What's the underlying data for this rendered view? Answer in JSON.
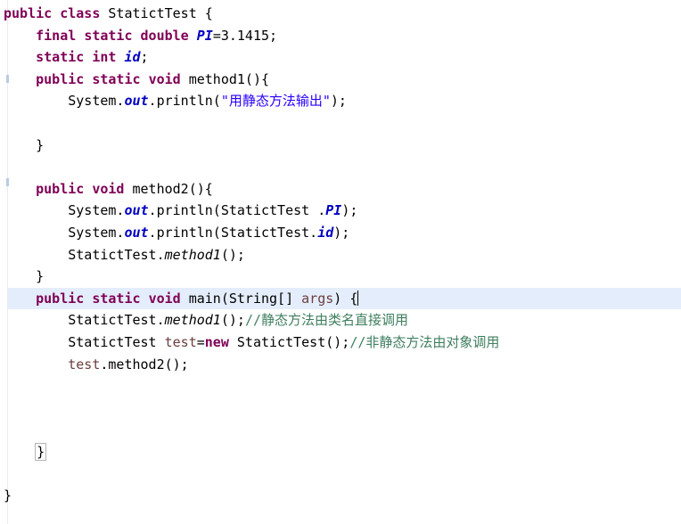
{
  "editor": {
    "language": "java",
    "class_name": "StatictTest",
    "colors": {
      "background": "#ffffff",
      "keyword": "#7f0055",
      "string": "#2a00ff",
      "comment": "#3f7f5f",
      "static_field": "#0000c0",
      "local_variable": "#6a3e3e",
      "plain_text": "#000000",
      "current_line_highlight": "#e4edfb",
      "bracket_match_outline": "#b4b4b4"
    },
    "current_line_number": 14,
    "caret_after": "{"
  },
  "lines": [
    {
      "n": 1,
      "indent": 0,
      "tokens": [
        {
          "t": "public",
          "c": "kw"
        },
        {
          "t": " ",
          "c": "plain"
        },
        {
          "t": "class",
          "c": "kw"
        },
        {
          "t": " ",
          "c": "plain"
        },
        {
          "t": "StatictTest",
          "c": "plain"
        },
        {
          "t": " {",
          "c": "plain"
        }
      ]
    },
    {
      "n": 2,
      "indent": 1,
      "tokens": [
        {
          "t": "final",
          "c": "kw"
        },
        {
          "t": " ",
          "c": "plain"
        },
        {
          "t": "static",
          "c": "kw"
        },
        {
          "t": " ",
          "c": "plain"
        },
        {
          "t": "double",
          "c": "kw"
        },
        {
          "t": " ",
          "c": "plain"
        },
        {
          "t": "PI",
          "c": "field"
        },
        {
          "t": "=",
          "c": "plain"
        },
        {
          "t": "3.1415",
          "c": "num"
        },
        {
          "t": ";",
          "c": "plain"
        }
      ]
    },
    {
      "n": 3,
      "indent": 1,
      "tokens": [
        {
          "t": "static",
          "c": "kw"
        },
        {
          "t": " ",
          "c": "plain"
        },
        {
          "t": "int",
          "c": "kw"
        },
        {
          "t": " ",
          "c": "plain"
        },
        {
          "t": "id",
          "c": "field"
        },
        {
          "t": ";",
          "c": "plain"
        }
      ]
    },
    {
      "n": 4,
      "indent": 1,
      "tokens": [
        {
          "t": "public",
          "c": "kw"
        },
        {
          "t": " ",
          "c": "plain"
        },
        {
          "t": "static",
          "c": "kw"
        },
        {
          "t": " ",
          "c": "plain"
        },
        {
          "t": "void",
          "c": "kw"
        },
        {
          "t": " ",
          "c": "plain"
        },
        {
          "t": "method1(){",
          "c": "plain"
        }
      ]
    },
    {
      "n": 5,
      "indent": 2,
      "tokens": [
        {
          "t": "System.",
          "c": "plain"
        },
        {
          "t": "out",
          "c": "sfield"
        },
        {
          "t": ".println(",
          "c": "plain"
        },
        {
          "t": "\"用静态方法输出\"",
          "c": "str"
        },
        {
          "t": ");",
          "c": "plain"
        }
      ]
    },
    {
      "n": 6,
      "indent": 0,
      "tokens": []
    },
    {
      "n": 7,
      "indent": 1,
      "tokens": [
        {
          "t": "}",
          "c": "plain"
        }
      ]
    },
    {
      "n": 8,
      "indent": 0,
      "tokens": []
    },
    {
      "n": 9,
      "indent": 1,
      "tokens": [
        {
          "t": "public",
          "c": "kw"
        },
        {
          "t": " ",
          "c": "plain"
        },
        {
          "t": "void",
          "c": "kw"
        },
        {
          "t": " ",
          "c": "plain"
        },
        {
          "t": "method2(){",
          "c": "plain"
        }
      ]
    },
    {
      "n": 10,
      "indent": 2,
      "tokens": [
        {
          "t": "System.",
          "c": "plain"
        },
        {
          "t": "out",
          "c": "sfield"
        },
        {
          "t": ".println(StatictTest .",
          "c": "plain"
        },
        {
          "t": "PI",
          "c": "field"
        },
        {
          "t": ");",
          "c": "plain"
        }
      ]
    },
    {
      "n": 11,
      "indent": 2,
      "tokens": [
        {
          "t": "System.",
          "c": "plain"
        },
        {
          "t": "out",
          "c": "sfield"
        },
        {
          "t": ".println(StatictTest.",
          "c": "plain"
        },
        {
          "t": "id",
          "c": "field"
        },
        {
          "t": ");",
          "c": "plain"
        }
      ]
    },
    {
      "n": 12,
      "indent": 2,
      "tokens": [
        {
          "t": "StatictTest.",
          "c": "plain"
        },
        {
          "t": "method1",
          "c": "smethod"
        },
        {
          "t": "();",
          "c": "plain"
        }
      ]
    },
    {
      "n": 13,
      "indent": 1,
      "tokens": [
        {
          "t": "}",
          "c": "plain"
        }
      ]
    },
    {
      "n": 14,
      "indent": 1,
      "highlight": true,
      "caret": true,
      "tokens": [
        {
          "t": "public",
          "c": "kw"
        },
        {
          "t": " ",
          "c": "plain"
        },
        {
          "t": "static",
          "c": "kw"
        },
        {
          "t": " ",
          "c": "plain"
        },
        {
          "t": "void",
          "c": "kw"
        },
        {
          "t": " ",
          "c": "plain"
        },
        {
          "t": "main(String[] ",
          "c": "plain"
        },
        {
          "t": "args",
          "c": "local"
        },
        {
          "t": ") {",
          "c": "plain"
        }
      ]
    },
    {
      "n": 15,
      "indent": 2,
      "tokens": [
        {
          "t": "StatictTest.",
          "c": "plain"
        },
        {
          "t": "method1",
          "c": "smethod"
        },
        {
          "t": "();",
          "c": "plain"
        },
        {
          "t": "//静态方法由类名直接调用",
          "c": "cmt"
        }
      ]
    },
    {
      "n": 16,
      "indent": 2,
      "tokens": [
        {
          "t": "StatictTest ",
          "c": "plain"
        },
        {
          "t": "test",
          "c": "local"
        },
        {
          "t": "=",
          "c": "plain"
        },
        {
          "t": "new",
          "c": "kw"
        },
        {
          "t": " StatictTest();",
          "c": "plain"
        },
        {
          "t": "//非静态方法由对象调用",
          "c": "cmt"
        }
      ]
    },
    {
      "n": 17,
      "indent": 2,
      "tokens": [
        {
          "t": "test",
          "c": "local"
        },
        {
          "t": ".method2();",
          "c": "plain"
        }
      ]
    },
    {
      "n": 18,
      "indent": 0,
      "tokens": []
    },
    {
      "n": 19,
      "indent": 0,
      "tokens": []
    },
    {
      "n": 20,
      "indent": 0,
      "tokens": []
    },
    {
      "n": 21,
      "indent": 1,
      "tokens": [
        {
          "t": "}",
          "c": "plain",
          "box": true
        }
      ]
    },
    {
      "n": 22,
      "indent": 0,
      "tokens": []
    },
    {
      "n": 23,
      "indent": 0,
      "tokens": [
        {
          "t": "}",
          "c": "plain"
        }
      ]
    }
  ]
}
